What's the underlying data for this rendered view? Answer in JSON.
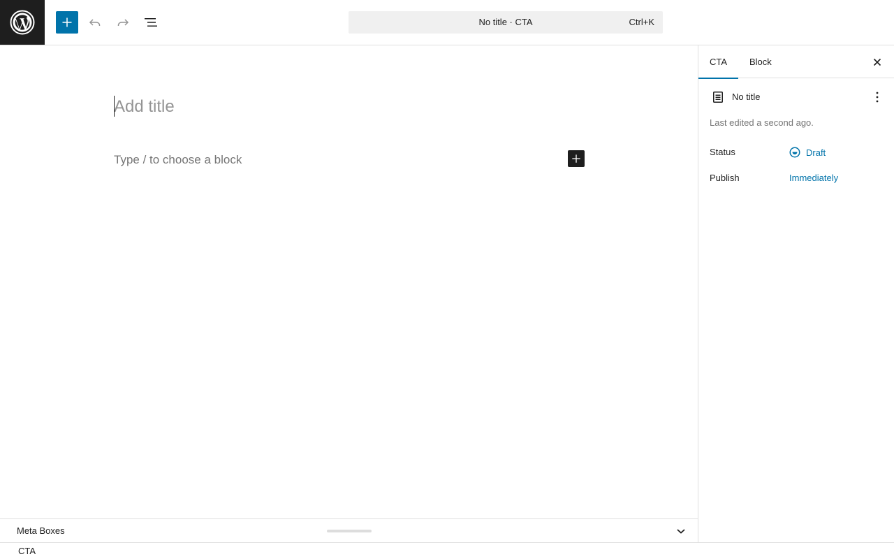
{
  "topbar": {
    "logo_icon": "wordpress-logo-icon",
    "add_block_icon": "plus-icon",
    "undo_icon": "undo-icon",
    "redo_icon": "redo-icon",
    "list_view_icon": "list-view-icon",
    "command_center": {
      "title": "No title · CTA",
      "shortcut": "Ctrl+K"
    }
  },
  "editor": {
    "title_placeholder": "Add title",
    "block_placeholder": "Type / to choose a block",
    "inserter_icon": "plus-icon"
  },
  "meta_boxes": {
    "label": "Meta Boxes",
    "toggle_icon": "chevron-down-icon"
  },
  "footer": {
    "breadcrumb": "CTA"
  },
  "sidebar": {
    "tabs": [
      {
        "label": "CTA",
        "active": true
      },
      {
        "label": "Block",
        "active": false
      }
    ],
    "close_icon": "close-icon",
    "document": {
      "icon": "page-icon",
      "title": "No title",
      "more_icon": "more-vertical-icon",
      "last_edited": "Last edited a second ago."
    },
    "status": {
      "label": "Status",
      "value": "Draft",
      "icon": "draft-icon"
    },
    "publish": {
      "label": "Publish",
      "value": "Immediately"
    }
  },
  "colors": {
    "accent": "#0073aa",
    "dark": "#1e1e1e",
    "muted": "#757575"
  }
}
